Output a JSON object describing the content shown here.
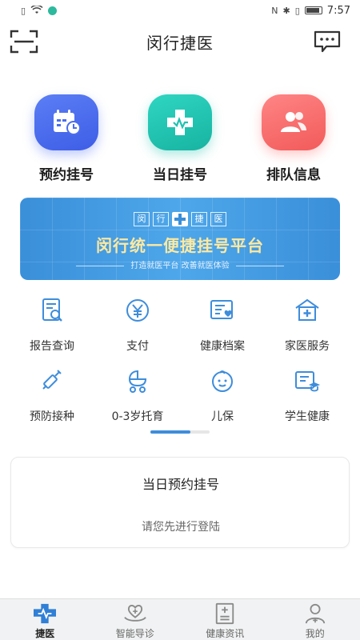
{
  "status_bar": {
    "time": "7:57"
  },
  "header": {
    "title": "闵行捷医"
  },
  "quick_actions": [
    {
      "label": "预约挂号",
      "icon": "calendar-clock-icon",
      "color": "#4a6df0"
    },
    {
      "label": "当日挂号",
      "icon": "medical-cross-icon",
      "color": "#1fc2b0"
    },
    {
      "label": "排队信息",
      "icon": "people-icon",
      "color": "#ff6f6f"
    }
  ],
  "banner": {
    "logo_chars": [
      "闵",
      "行",
      "捷",
      "医"
    ],
    "title": "闵行统一便捷挂号平台",
    "subtitle": "打造就医平台 改善就医体验"
  },
  "services": [
    {
      "label": "报告查询",
      "icon": "report-search-icon"
    },
    {
      "label": "支付",
      "icon": "yuan-payment-icon"
    },
    {
      "label": "健康档案",
      "icon": "health-record-icon"
    },
    {
      "label": "家医服务",
      "icon": "family-doctor-house-icon"
    },
    {
      "label": "预防接种",
      "icon": "syringe-icon"
    },
    {
      "label": "0-3岁托育",
      "icon": "baby-stroller-icon"
    },
    {
      "label": "儿保",
      "icon": "baby-face-icon"
    },
    {
      "label": "学生健康",
      "icon": "student-graduation-icon"
    }
  ],
  "pager": {
    "pages": 2,
    "current": 1
  },
  "appointment_card": {
    "title": "当日预约挂号",
    "message": "请您先进行登陆"
  },
  "tabbar": [
    {
      "label": "捷医",
      "icon": "jieyi-logo-icon",
      "active": true
    },
    {
      "label": "智能导诊",
      "icon": "heart-hand-icon",
      "active": false
    },
    {
      "label": "健康资讯",
      "icon": "news-document-icon",
      "active": false
    },
    {
      "label": "我的",
      "icon": "user-profile-icon",
      "active": false
    }
  ],
  "colors": {
    "accent": "#3e8ddb",
    "banner": "#4ea7ea",
    "service_icon": "#3e8ddb"
  }
}
